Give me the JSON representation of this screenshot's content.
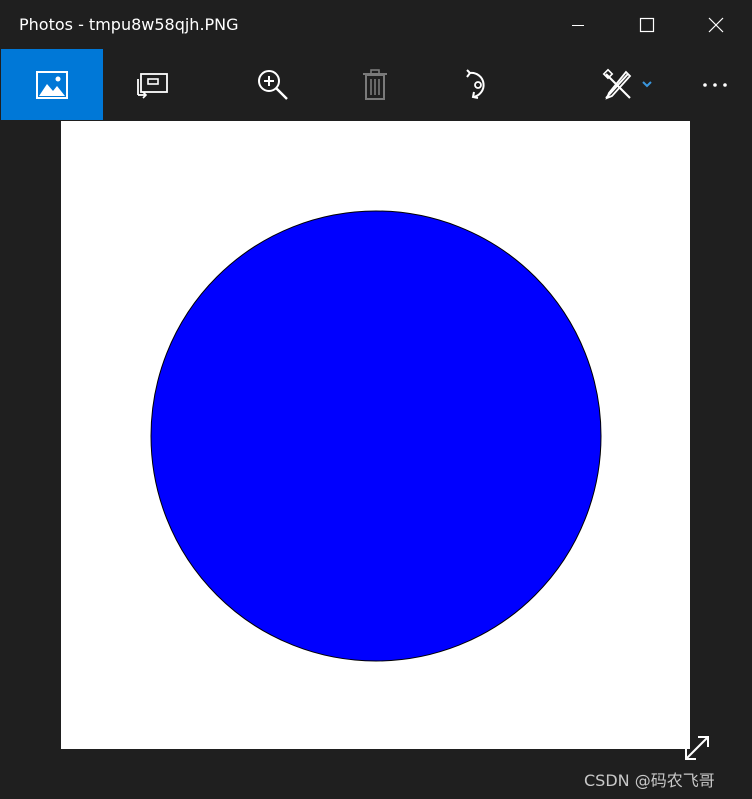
{
  "window": {
    "title": "Photos - tmpu8w58qjh.PNG"
  },
  "window_controls": {
    "minimize_icon": "minimize-icon",
    "maximize_icon": "maximize-icon",
    "close_icon": "close-icon"
  },
  "toolbar": {
    "buttons": [
      {
        "icon": "photo-icon",
        "active": true
      },
      {
        "icon": "slideshow-icon"
      },
      {
        "icon": "zoom-in-icon"
      },
      {
        "icon": "delete-icon",
        "disabled": true
      },
      {
        "icon": "rotate-icon"
      },
      {
        "icon": "edit-draw-icon",
        "dropdown": true
      },
      {
        "icon": "more-icon"
      }
    ]
  },
  "image": {
    "background": "#ffffff",
    "shape": "circle",
    "fill_color": "#0000ff",
    "stroke_color": "#000000"
  },
  "viewer": {
    "fullscreen_icon": "fullscreen-icon"
  },
  "watermark": {
    "text": "CSDN @码农飞哥"
  },
  "colors": {
    "accent": "#0078d7",
    "chrome_bg": "#1f1f1f"
  }
}
